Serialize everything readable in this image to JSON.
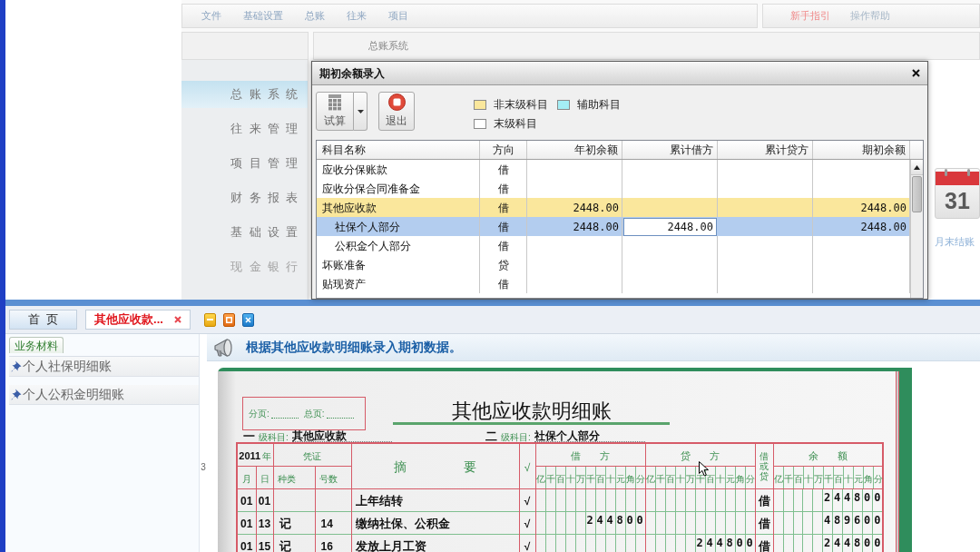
{
  "background_app": {
    "menu": [
      {
        "label": "文件"
      },
      {
        "label": "基础设置"
      },
      {
        "label": "总账"
      },
      {
        "label": "往来"
      },
      {
        "label": "项目"
      }
    ],
    "help_links": [
      {
        "label": "新手指引",
        "kind": "guide"
      },
      {
        "label": "操作帮助",
        "kind": "help"
      }
    ],
    "module_tab": "总账系统",
    "nav": [
      {
        "label": "总账系统",
        "selected": true,
        "disabled": false
      },
      {
        "label": "往来管理",
        "selected": false,
        "disabled": false
      },
      {
        "label": "项目管理",
        "selected": false,
        "disabled": false
      },
      {
        "label": "财务报表",
        "selected": false,
        "disabled": false
      },
      {
        "label": "基础设置",
        "selected": false,
        "disabled": false
      },
      {
        "label": "现金银行",
        "selected": false,
        "disabled": true
      }
    ],
    "calendar": {
      "day": "31",
      "label": "月末结账"
    }
  },
  "dialog": {
    "title": "期初余额录入",
    "toolbar": [
      {
        "label": "试算",
        "kind": "trial"
      },
      {
        "label": "退出",
        "kind": "exit"
      }
    ],
    "legend": [
      {
        "label": "非末级科目",
        "kind": "non_leaf",
        "color": "#fae79c"
      },
      {
        "label": "辅助科目",
        "kind": "auxiliary",
        "color": "#a4eef5"
      },
      {
        "label": "末级科目",
        "kind": "leaf",
        "color": "#ffffff"
      }
    ],
    "columns": [
      "科目名称",
      "方向",
      "年初余额",
      "累计借方",
      "累计贷方",
      "期初余额"
    ],
    "rows": [
      {
        "name": "应收分保账款",
        "direction": "借",
        "selected": false,
        "editing": false
      },
      {
        "name": "应收分保合同准备金",
        "direction": "借",
        "selected": false,
        "editing": false
      },
      {
        "name": "其他应收款",
        "direction": "借",
        "year_start": "2448.00",
        "balance": "2448.00",
        "selected": false,
        "editing": false,
        "children": [
          {
            "name": "社保个人部分",
            "direction": "借",
            "year_start": "2448.00",
            "debit": "2448.00",
            "balance": "2448.00",
            "selected": true,
            "editing": true
          },
          {
            "name": "公积金个人部分",
            "direction": "借",
            "selected": false,
            "editing": false
          }
        ]
      },
      {
        "name": "坏账准备",
        "direction": "贷",
        "selected": false,
        "editing": false
      },
      {
        "name": "贴现资产",
        "direction": "借",
        "selected": false,
        "editing": false
      }
    ]
  },
  "workspace": {
    "tabs": [
      {
        "label": "首页",
        "selected": false,
        "closable": false
      },
      {
        "label": "其他应收款...",
        "selected": true,
        "closable": true
      }
    ],
    "window_buttons": [
      {
        "kind": "minimize"
      },
      {
        "kind": "restore"
      },
      {
        "kind": "close"
      }
    ],
    "materials": {
      "tab": "业务材料",
      "items": [
        {
          "label": "个人社保明细账"
        },
        {
          "label": "个人公积金明细账"
        }
      ]
    },
    "page_marker": "3",
    "instruction": "根据其他应收款明细账录入期初数据。",
    "ledger": {
      "page_fields": [
        "分页:",
        "总页:"
      ],
      "title": "其他应收款明细账",
      "accounts": [
        {
          "number": "一",
          "label": "级科目:",
          "value": "其他应收款"
        },
        {
          "number": "二",
          "label": "级科目:",
          "value": "社保个人部分"
        }
      ],
      "year": "2011",
      "year_label": "年",
      "voucher": "凭证",
      "month": "月",
      "day": "日",
      "voucher_type": "种类",
      "voucher_no": "号数",
      "summary": "摘 要",
      "check": "√",
      "amount_columns": [
        {
          "label": "借 方",
          "units": [
            "亿",
            "千",
            "百",
            "十",
            "万",
            "千",
            "百",
            "十",
            "元",
            "角",
            "分"
          ]
        },
        {
          "label": "贷 方",
          "units": [
            "亿",
            "千",
            "百",
            "十",
            "万",
            "千",
            "百",
            "十",
            "元",
            "角",
            "分"
          ]
        }
      ],
      "direction": "借或贷",
      "balance": {
        "label": "余 额",
        "units": [
          "亿",
          "千",
          "百",
          "十",
          "万",
          "千",
          "百",
          "十",
          "元",
          "角",
          "分"
        ]
      },
      "rows": [
        {
          "month": "01",
          "day": "01",
          "summary": "上年结转",
          "check": "√",
          "direction": "借",
          "balance": "244800"
        },
        {
          "month": "01",
          "day": "13",
          "voucher_type": "记",
          "voucher_no": "14",
          "summary": "缴纳社保、公积金",
          "check": "√",
          "debit": "244800",
          "direction": "借",
          "balance": "489600"
        },
        {
          "month": "01",
          "day": "15",
          "voucher_type": "记",
          "voucher_no": "16",
          "summary": "发放上月工资",
          "check": "√",
          "credit": "244800",
          "direction": "借",
          "balance": "244800"
        }
      ]
    }
  }
}
